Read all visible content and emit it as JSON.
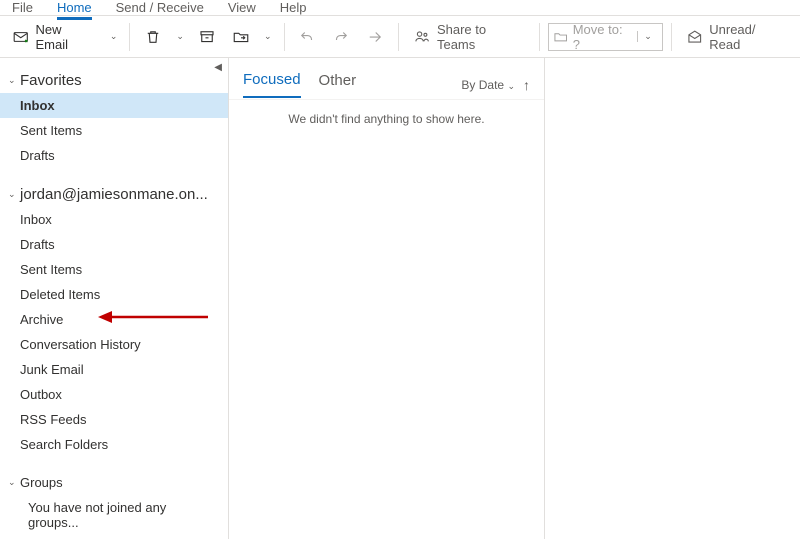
{
  "tabs": {
    "file": "File",
    "home": "Home",
    "send": "Send / Receive",
    "view": "View",
    "help": "Help"
  },
  "toolbar": {
    "new_email": "New Email",
    "share_teams": "Share to Teams",
    "moveto": "Move to: ?",
    "unread_read": "Unread/ Read"
  },
  "sidebar": {
    "favorites": {
      "title": "Favorites",
      "items": [
        "Inbox",
        "Sent Items",
        "Drafts"
      ]
    },
    "account": {
      "title": "jordan@jamiesonmane.on...",
      "items": [
        "Inbox",
        "Drafts",
        "Sent Items",
        "Deleted Items",
        "Archive",
        "Conversation History",
        "Junk Email",
        "Outbox",
        "RSS Feeds",
        "Search Folders"
      ]
    },
    "groups": {
      "title": "Groups",
      "empty": "You have not joined any groups..."
    }
  },
  "messages": {
    "focused": "Focused",
    "other": "Other",
    "sort": "By Date",
    "empty": "We didn't find anything to show here."
  }
}
